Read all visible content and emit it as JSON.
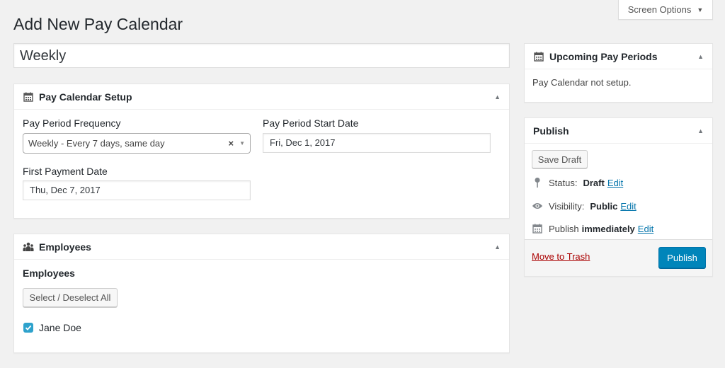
{
  "screen_options": {
    "label": "Screen Options"
  },
  "page": {
    "title": "Add New Pay Calendar"
  },
  "title_input": {
    "value": "Weekly"
  },
  "setup_box": {
    "title": "Pay Calendar Setup",
    "frequency_label": "Pay Period Frequency",
    "frequency_value": "Weekly - Every 7 days, same day",
    "start_label": "Pay Period Start Date",
    "start_value": "Fri,  Dec 1, 2017",
    "first_payment_label": "First Payment Date",
    "first_payment_value": "Thu,  Dec 7, 2017"
  },
  "employees_box": {
    "title": "Employees",
    "section_label": "Employees",
    "select_all_label": "Select / Deselect All",
    "employees": [
      {
        "name": "Jane Doe",
        "checked": true
      }
    ]
  },
  "upcoming_box": {
    "title": "Upcoming Pay Periods",
    "message": "Pay Calendar not setup."
  },
  "publish_box": {
    "title": "Publish",
    "save_draft_label": "Save Draft",
    "status_label": "Status:",
    "status_value": "Draft",
    "visibility_label": "Visibility:",
    "visibility_value": "Public",
    "publish_label": "Publish",
    "publish_value": "immediately",
    "edit_label": "Edit",
    "trash_label": "Move to Trash",
    "publish_button_label": "Publish"
  },
  "colors": {
    "primary": "#0085ba",
    "link": "#0073aa",
    "trash": "#aa0000",
    "checkbox": "#2ea2cc"
  },
  "icons": [
    "calendar-icon",
    "group-icon",
    "pin-icon",
    "eye-icon",
    "chevron-up-icon",
    "chevron-down-icon",
    "checkmark-icon"
  ]
}
